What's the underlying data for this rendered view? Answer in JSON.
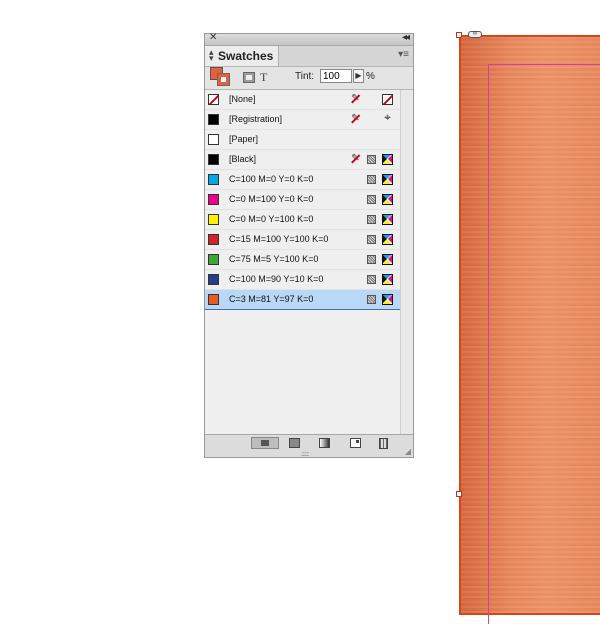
{
  "panel": {
    "title": "Swatches",
    "close_glyph": "✕",
    "collapse_glyph": "◂◂",
    "menu_glyph": "▾≡",
    "tint_label": "Tint:",
    "tint_value": "100",
    "tint_unit": "%",
    "tint_arrow_glyph": "▶",
    "text_format_glyph": "T",
    "fill_color": "#e8603a",
    "swatches": [
      {
        "name": "[None]",
        "color": "none",
        "non_editable": true,
        "type_icon": "none-box-icon"
      },
      {
        "name": "[Registration]",
        "color": "#000000",
        "non_editable": true,
        "type_icon": "registration-icon"
      },
      {
        "name": "[Paper]",
        "color": "#ffffff",
        "non_editable": false,
        "type_icon": ""
      },
      {
        "name": "[Black]",
        "color": "#000000",
        "non_editable": true,
        "type_icon": "cmyk-icon"
      },
      {
        "name": "C=100 M=0 Y=0 K=0",
        "color": "#00a8e8",
        "non_editable": false,
        "type_icon": "cmyk-icon"
      },
      {
        "name": "C=0 M=100 Y=0 K=0",
        "color": "#ec008c",
        "non_editable": false,
        "type_icon": "cmyk-icon"
      },
      {
        "name": "C=0 M=0 Y=100 K=0",
        "color": "#fff200",
        "non_editable": false,
        "type_icon": "cmyk-icon"
      },
      {
        "name": "C=15 M=100 Y=100 K=0",
        "color": "#d2232a",
        "non_editable": false,
        "type_icon": "cmyk-icon"
      },
      {
        "name": "C=75 M=5 Y=100 K=0",
        "color": "#3fa535",
        "non_editable": false,
        "type_icon": "cmyk-icon"
      },
      {
        "name": "C=100 M=90 Y=10 K=0",
        "color": "#263c8c",
        "non_editable": false,
        "type_icon": "cmyk-icon"
      },
      {
        "name": "C=3 M=81 Y=97 K=0",
        "color": "#e85a27",
        "non_editable": false,
        "type_icon": "cmyk-icon",
        "selected": true
      }
    ],
    "bottom_buttons": [
      "show-all-swatches-icon",
      "new-color-group-icon",
      "gradient-icon",
      "new-swatch-icon",
      "trash-icon"
    ]
  },
  "document": {
    "page_color": "#ea8a5e",
    "margin_color": "#d23fa0",
    "frame_color": "#d6461e"
  }
}
